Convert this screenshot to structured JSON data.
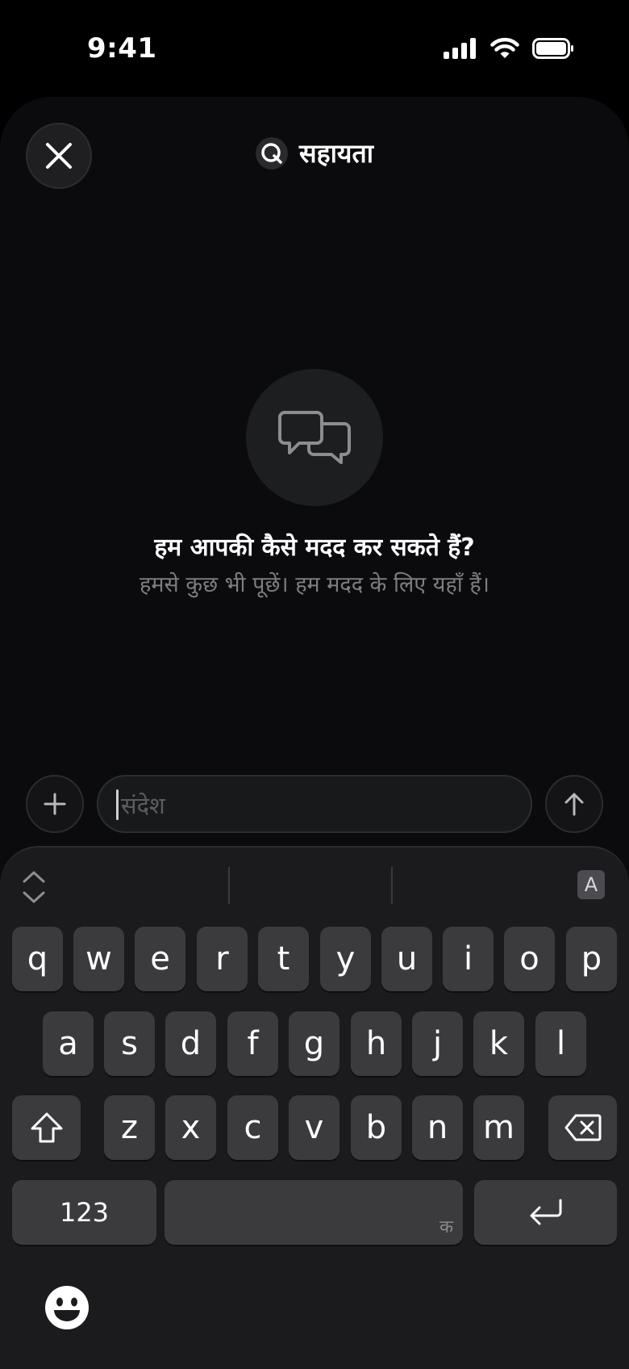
{
  "status_bar": {
    "time": "9:41"
  },
  "header": {
    "title": "सहायता"
  },
  "empty_state": {
    "heading": "हम आपकी कैसे मदद कर सकते हैं?",
    "subheading": "हमसे कुछ भी पूछें। हम मदद के लिए यहाँ हैं।"
  },
  "composer": {
    "placeholder": "संदेश"
  },
  "keyboard": {
    "row1": [
      "q",
      "w",
      "e",
      "r",
      "t",
      "y",
      "u",
      "i",
      "o",
      "p"
    ],
    "row2": [
      "a",
      "s",
      "d",
      "f",
      "g",
      "h",
      "j",
      "k",
      "l"
    ],
    "row3": [
      "z",
      "x",
      "c",
      "v",
      "b",
      "n",
      "m"
    ],
    "numbers_label": "123",
    "space_hint": "क",
    "language_badge": "A"
  },
  "colors": {
    "background": "#000000",
    "sheet": "#0b0b0d",
    "key": "#3b3b3e",
    "keyboard": "#1b1b1d"
  }
}
